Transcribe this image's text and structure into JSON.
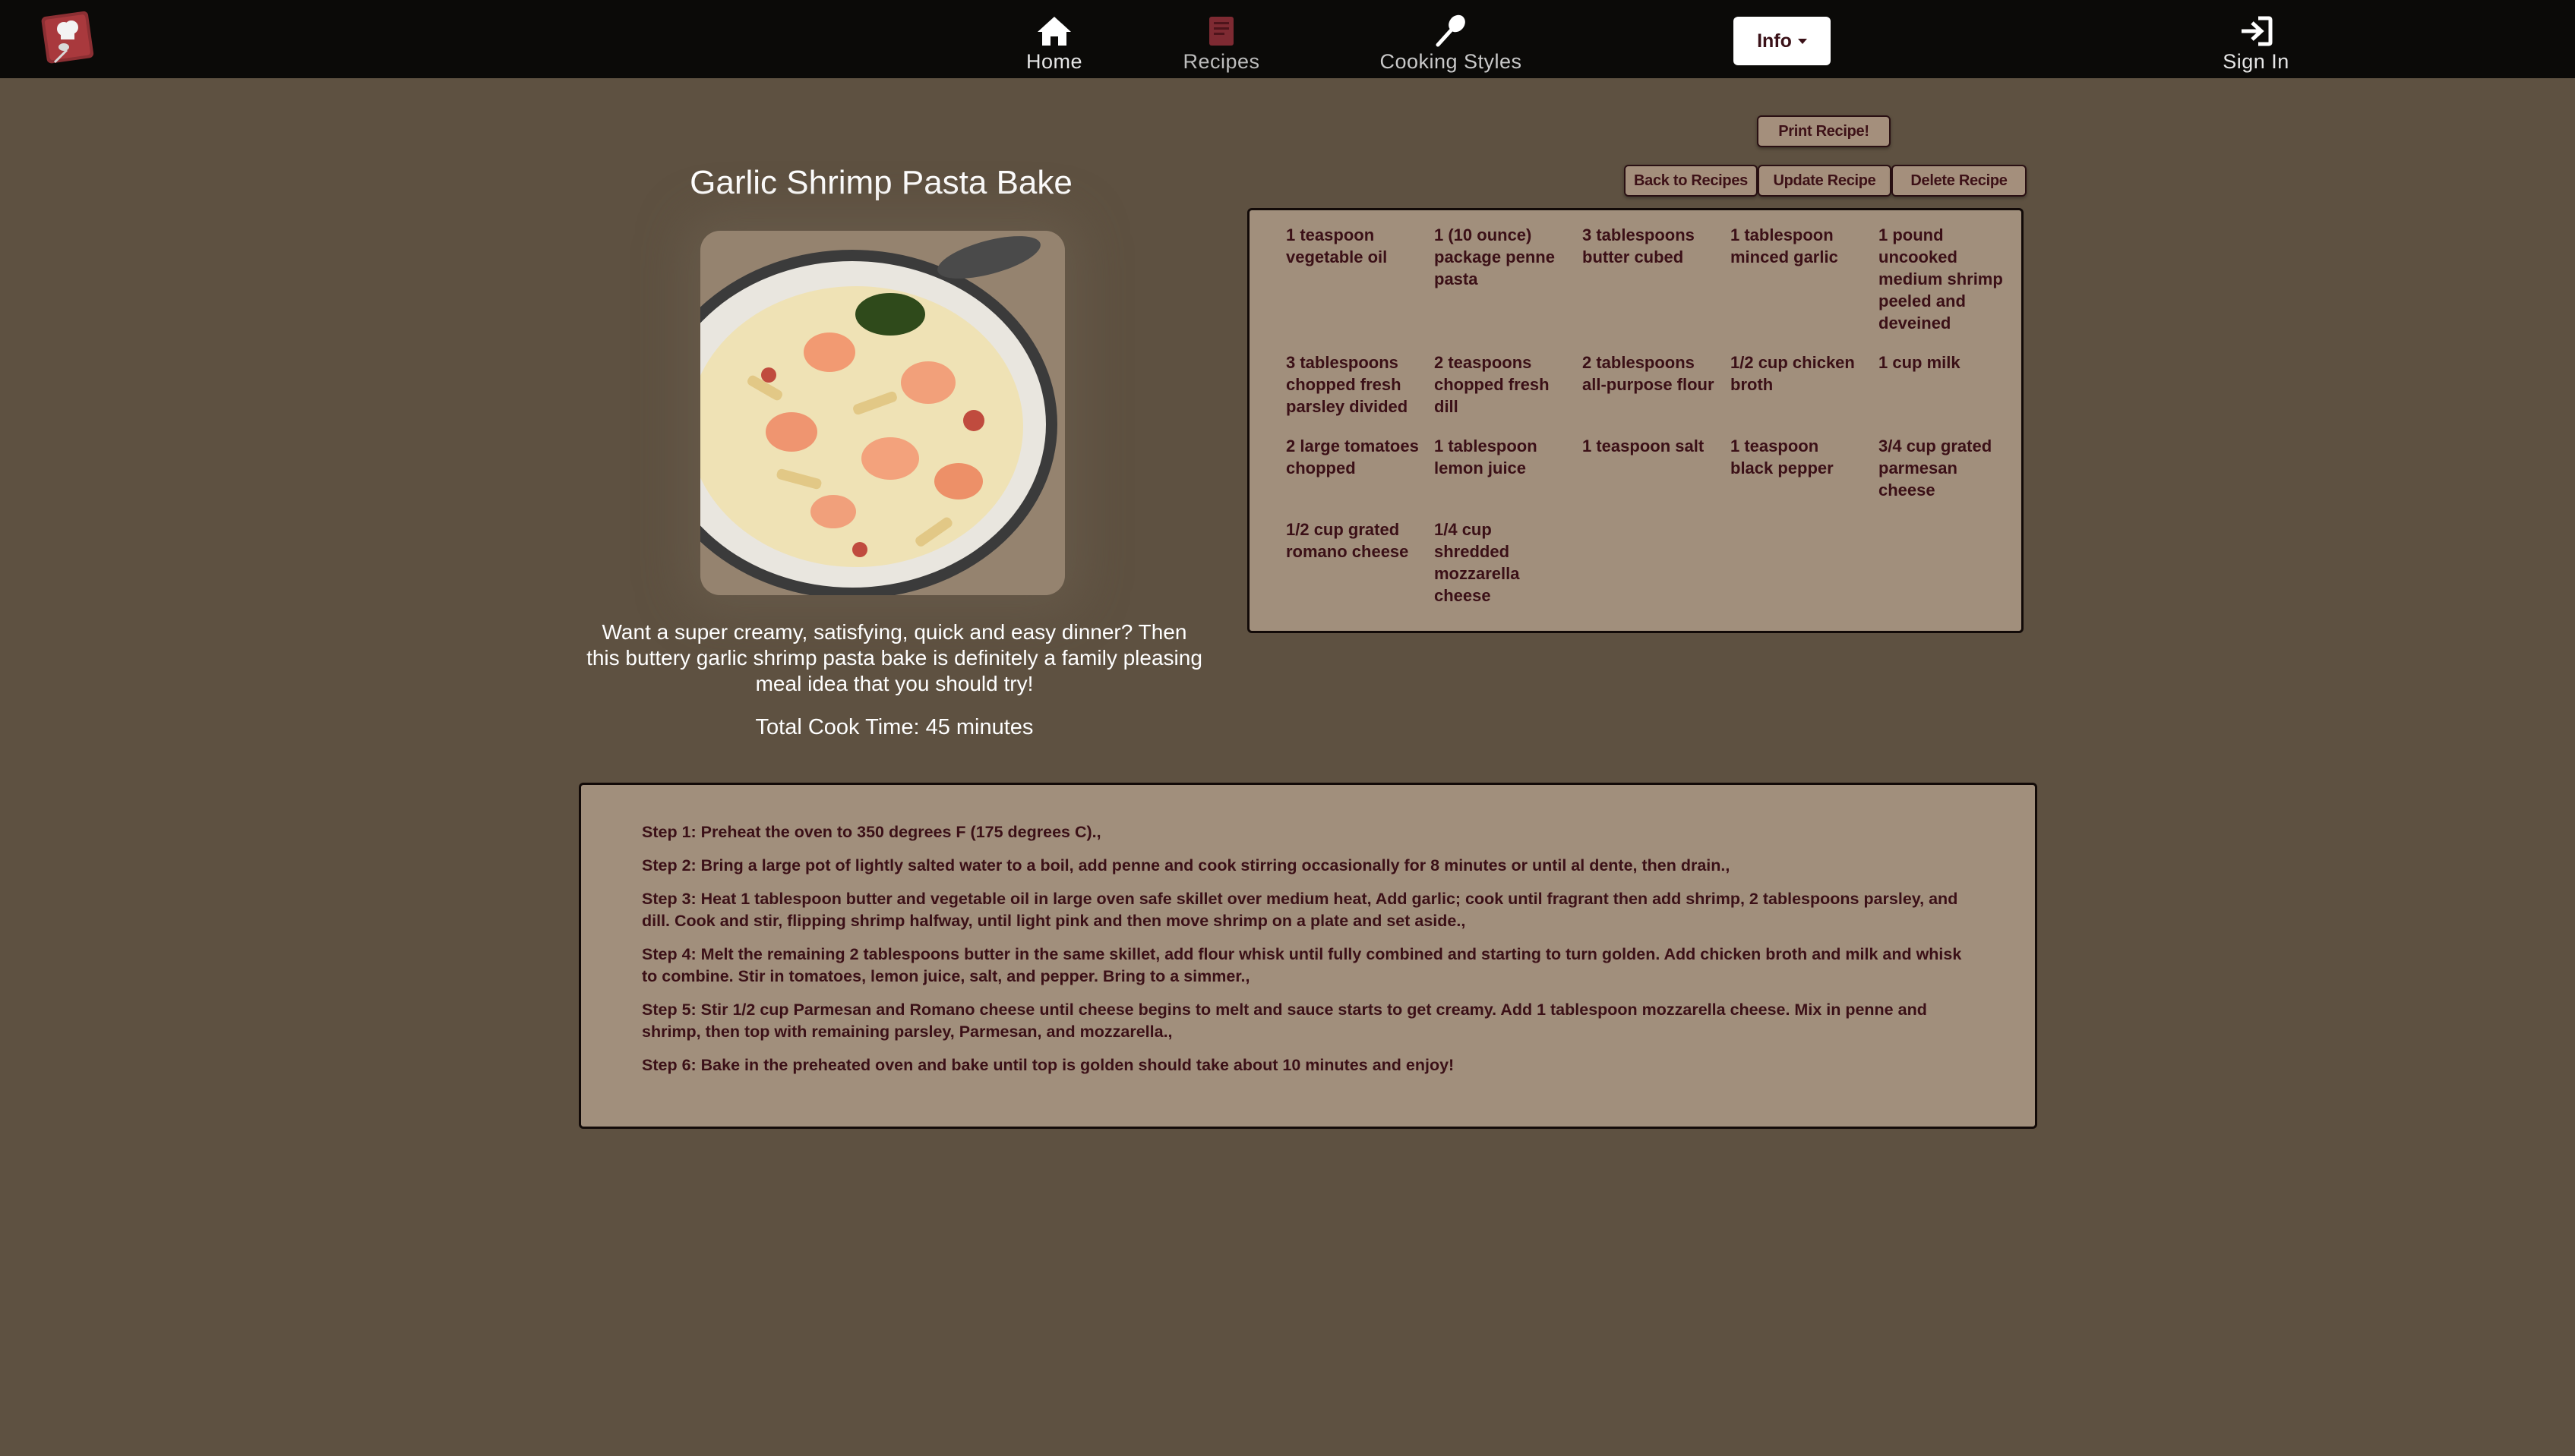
{
  "nav": {
    "logo_icon": "chef-hat-logo-icon",
    "home": {
      "label": "Home",
      "icon": "home-icon"
    },
    "recipes": {
      "label": "Recipes",
      "icon": "book-icon"
    },
    "cooking_styles": {
      "label": "Cooking Styles",
      "icon": "spoon-icon"
    },
    "info": {
      "label": "Info"
    },
    "sign_in": {
      "label": "Sign In",
      "icon": "sign-in-icon"
    }
  },
  "recipe": {
    "title": "Garlic Shrimp Pasta Bake",
    "description": "Want a super creamy, satisfying, quick and easy dinner? Then this buttery garlic shrimp pasta bake is definitely a family pleasing meal idea that you should try!",
    "cook_time": "Total Cook Time: 45 minutes"
  },
  "actions": {
    "print": "Print Recipe!",
    "back": "Back to Recipes",
    "update": "Update Recipe",
    "delete": "Delete Recipe"
  },
  "ingredients": [
    "1 teaspoon vegetable oil",
    "1 (10 ounce) package penne pasta",
    "3 tablespoons butter cubed",
    "1 tablespoon minced garlic",
    "1 pound uncooked medium shrimp peeled and deveined",
    "3 tablespoons chopped fresh parsley divided",
    "2 teaspoons chopped fresh dill",
    "2 tablespoons all-purpose flour",
    "1/2 cup chicken broth",
    "1 cup milk",
    "2 large tomatoes chopped",
    "1 tablespoon lemon juice",
    "1 teaspoon salt",
    "1 teaspoon black pepper",
    "3/4 cup grated parmesan cheese",
    "1/2 cup grated romano cheese",
    "1/4 cup shredded mozzarella cheese"
  ],
  "steps": [
    "Step 1: Preheat the oven to 350 degrees F (175 degrees C).,",
    "Step 2: Bring a large pot of lightly salted water to a boil, add penne and cook stirring occasionally for 8 minutes or until al dente, then drain.,",
    "Step 3: Heat 1 tablespoon butter and vegetable oil in large oven safe skillet over medium heat, Add garlic; cook until fragrant then add shrimp, 2 tablespoons parsley, and dill. Cook and stir, flipping shrimp halfway, until light pink and then move shrimp on a plate and set aside.,",
    "Step 4: Melt the remaining 2 tablespoons butter in the same skillet, add flour whisk until fully combined and starting to turn golden. Add chicken broth and milk and whisk to combine. Stir in tomatoes, lemon juice, salt, and pepper. Bring to a simmer.,",
    "Step 5: Stir 1/2 cup Parmesan and Romano cheese until cheese begins to melt and sauce starts to get creamy. Add 1 tablespoon mozzarella cheese. Mix in penne and shrimp, then top with remaining parsley, Parmesan, and mozzarella.,",
    "Step 6: Bake in the preheated oven and bake until top is golden should take about 10 minutes and enjoy!"
  ]
}
